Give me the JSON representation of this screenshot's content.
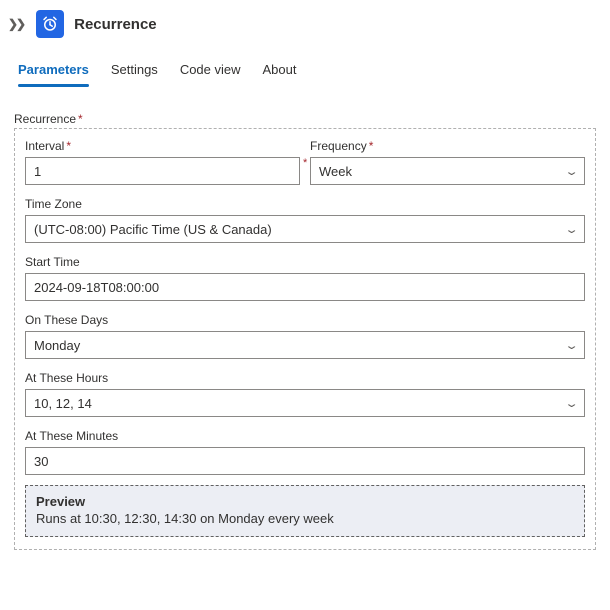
{
  "header": {
    "title": "Recurrence"
  },
  "tabs": {
    "parameters": "Parameters",
    "settings": "Settings",
    "codeview": "Code view",
    "about": "About"
  },
  "group": {
    "label": "Recurrence"
  },
  "fields": {
    "interval": {
      "label": "Interval",
      "value": "1"
    },
    "frequency": {
      "label": "Frequency",
      "value": "Week"
    },
    "timezone": {
      "label": "Time Zone",
      "value": "(UTC-08:00) Pacific Time (US & Canada)"
    },
    "starttime": {
      "label": "Start Time",
      "value": "2024-09-18T08:00:00"
    },
    "days": {
      "label": "On These Days",
      "value": "Monday"
    },
    "hours": {
      "label": "At These Hours",
      "value": "10, 12, 14"
    },
    "minutes": {
      "label": "At These Minutes",
      "value": "30"
    }
  },
  "preview": {
    "title": "Preview",
    "text": "Runs at 10:30, 12:30, 14:30 on Monday every week"
  }
}
